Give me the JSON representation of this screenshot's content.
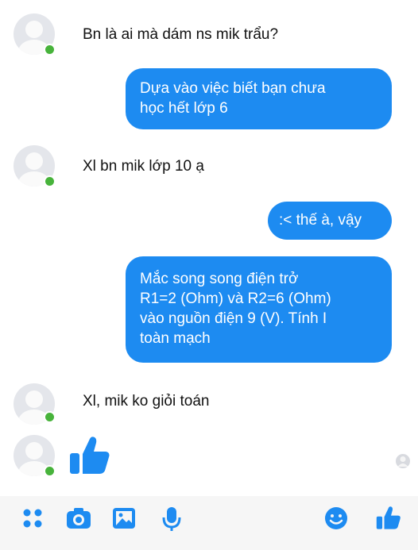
{
  "messages": [
    {
      "from": "them",
      "text": "Bn là ai mà dám ns mik trẩu?"
    },
    {
      "from": "me",
      "lines": [
        "Dựa vào việc biết bạn chưa",
        "học hết lớp 6"
      ]
    },
    {
      "from": "them",
      "text": "Xl bn mik lớp 10 ạ"
    },
    {
      "from": "me",
      "lines": [
        ":< thế à, vậy"
      ]
    },
    {
      "from": "me",
      "lines": [
        "Mắc song song điện trở",
        "R1=2 (Ohm) và R2=6 (Ohm)",
        "vào nguồn điện 9 (V). Tính I",
        "toàn mạch"
      ]
    },
    {
      "from": "them",
      "text": "Xl, mik ko giỏi toán"
    }
  ],
  "like_reaction": {
    "icon": "thumbs-up-icon",
    "color": "#1d8bf1"
  },
  "composer": {
    "icons": [
      "menu-dots-icon",
      "camera-icon",
      "gallery-icon",
      "microphone-icon",
      "emoji-icon",
      "thumbs-up-icon"
    ]
  },
  "colors": {
    "accent": "#1d8bf1",
    "online": "#47b33b",
    "bubble_text": "#ffffff"
  }
}
